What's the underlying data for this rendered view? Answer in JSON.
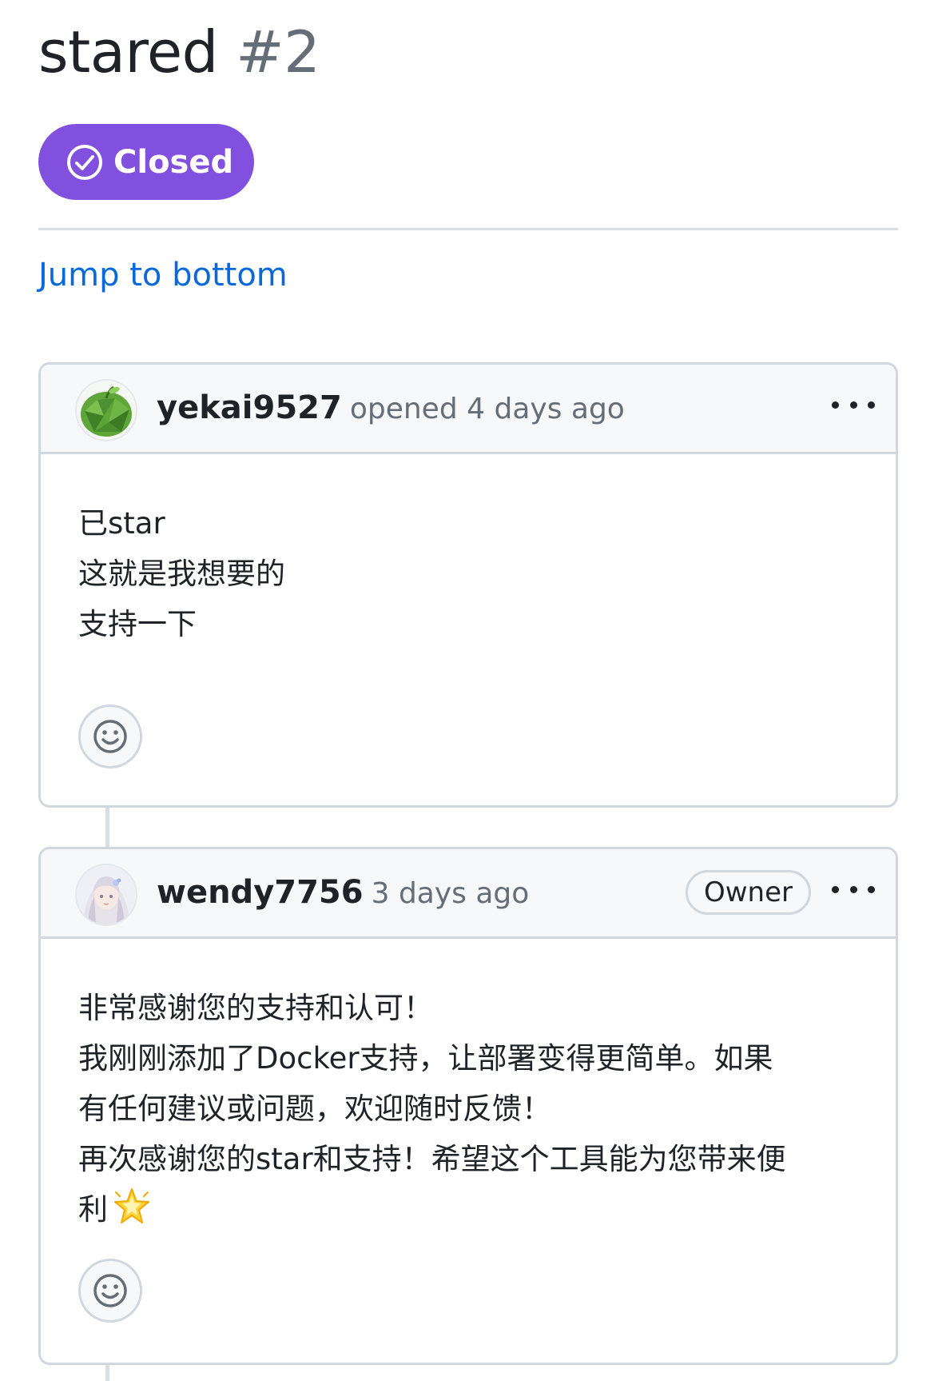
{
  "issue": {
    "title": "stared",
    "number": "#2",
    "state_label": "Closed",
    "jump_link": "Jump to bottom"
  },
  "comments": [
    {
      "author": "yekai9527",
      "meta": "opened 4 days ago",
      "badge": "",
      "lines": [
        "已star",
        "这就是我想要的",
        "支持一下"
      ]
    },
    {
      "author": "wendy7756",
      "meta": "3 days ago",
      "badge": "Owner",
      "lines": [
        "非常感谢您的支持和认可！",
        "我刚刚添加了Docker支持，让部署变得更简单。如果",
        "有任何建议或问题，欢迎随时反馈！",
        "再次感谢您的star和支持！希望这个工具能为您带来便",
        "利"
      ]
    }
  ],
  "colors": {
    "closed_badge": "#8250df",
    "link": "#0969da",
    "muted_text": "#656d76",
    "border": "#d0d7de",
    "header_bg": "#f6f8fa"
  },
  "icons": {
    "state": "check-circle-icon",
    "reaction": "smiley-icon",
    "menu": "kebab-horizontal-icon",
    "emoji": "glowing-star-emoji"
  }
}
